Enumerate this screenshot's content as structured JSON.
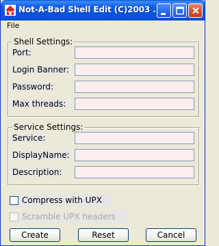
{
  "window": {
    "title": "Not-A-Bad Shell Edit (C)2003 ...",
    "title_bar_color": "#0a5bd7"
  },
  "menu": {
    "file": "File"
  },
  "shell_settings": {
    "legend": "Shell Settings:",
    "fields": [
      {
        "label": "Port:",
        "value": ""
      },
      {
        "label": "Login Banner:",
        "value": ""
      },
      {
        "label": "Password:",
        "value": ""
      },
      {
        "label": "Max threads:",
        "value": ""
      }
    ]
  },
  "service_settings": {
    "legend": "Service Settings:",
    "fields": [
      {
        "label": "Service:",
        "value": ""
      },
      {
        "label": "DisplayName:",
        "value": ""
      },
      {
        "label": "Description:",
        "value": ""
      }
    ]
  },
  "options": {
    "compress_upx": {
      "label": "Compress with UPX",
      "checked": false,
      "enabled": true
    },
    "scramble_upx": {
      "label": "Scramble UPX headers",
      "checked": false,
      "enabled": false
    }
  },
  "buttons": {
    "create": "Create",
    "reset": "Reset",
    "cancel": "Cancel"
  },
  "colors": {
    "input_background": "#fcedee",
    "window_background": "#ece9d8",
    "disabled_text": "#aca899"
  },
  "icons": {
    "app": "red-house-icon",
    "minimize": "minimize-icon",
    "maximize": "maximize-icon",
    "close": "close-icon"
  }
}
